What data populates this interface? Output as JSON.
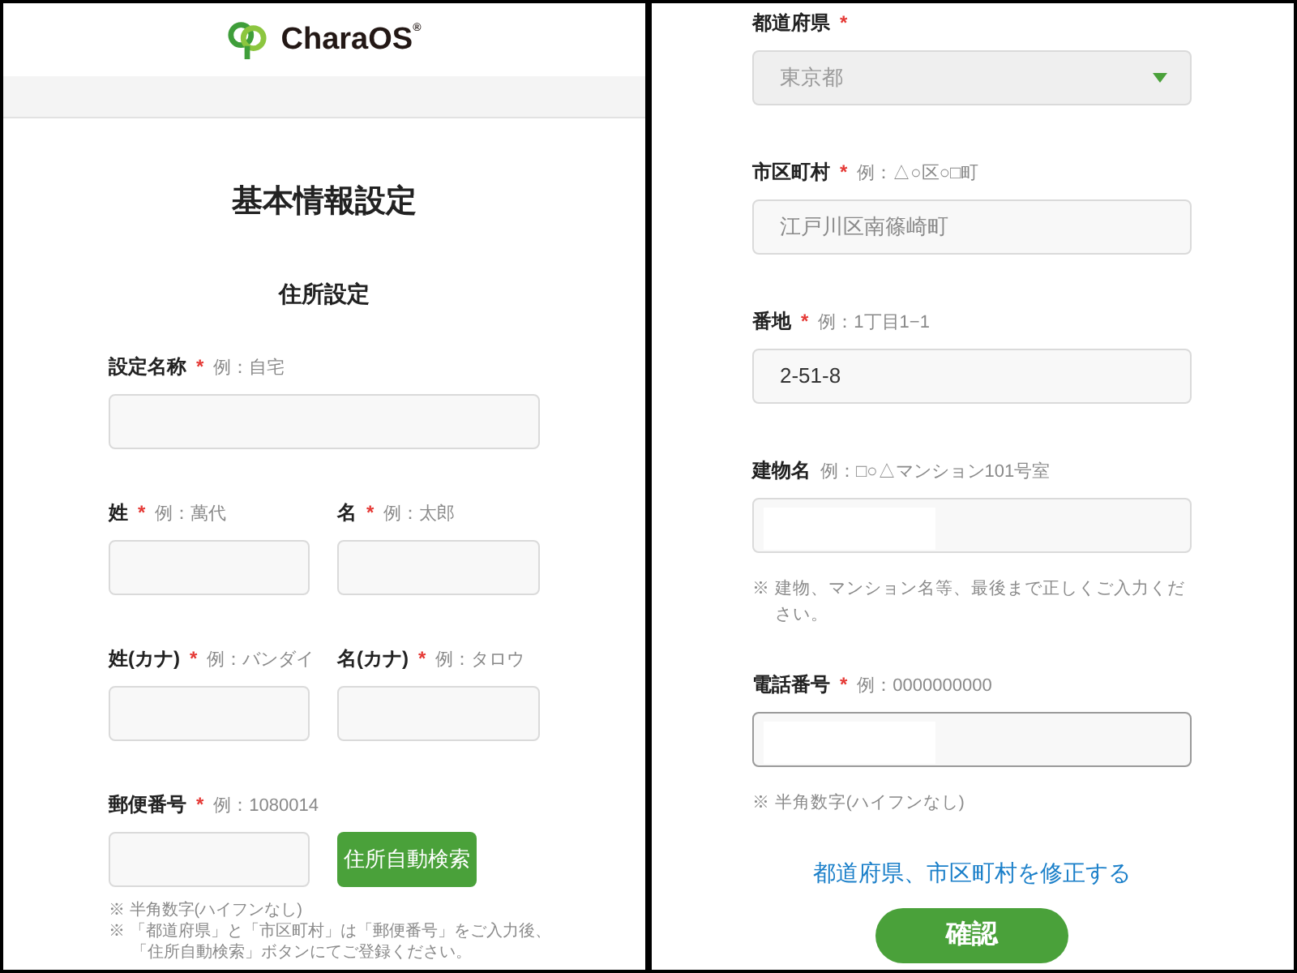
{
  "left_screen": {
    "logo": "CharaOS$^{®}$",
    "title": "基本情報設定",
    "subtitle": "住所設定",
    "rows": [
      {
        "fields": [
          {
            "label": "設定名称",
            "required_mark": "*",
            "example": "例：自宅"
          }
        ]
      },
      {
        "fields": [
          {
            "label": "姓",
            "required_mark": "*",
            "example": "例：萬代"
          },
          {
            "label": "名",
            "required_mark": "*",
            "example": "例：太郎"
          }
        ]
      },
      {
        "fields": [
          {
            "label": "姓(カナ)",
            "required_mark": "*",
            "example": "例：バンダイ"
          },
          {
            "label": "名(カナ)",
            "required_mark": "*",
            "example": "例：タロウ"
          }
        ]
      },
      {
        "fields": [
          {
            "label": "郵便番号",
            "required_mark": "*",
            "example": "例：1080014"
          }
        ],
        "button": "住所自動検索"
      }
    ],
    "notes": [
      "※ 半角数字(ハイフンなし)",
      "※ 「都道府県」と「市区町村」は「郵便番号」をご入力後、「住所自動検索」ボタンにてご登録ください。"
    ]
  },
  "right_screen": {
    "fields": [
      {
        "kind": "select",
        "label": "都道府県",
        "required_mark": "*",
        "value": "東京都",
        "disabled": true
      },
      {
        "kind": "text",
        "label": "市区町村",
        "required_mark": "*",
        "example": "例：△○区○□町",
        "value": "江戸川区南篠崎町",
        "disabled": true,
        "focused": false
      },
      {
        "kind": "text",
        "label": "番地",
        "required_mark": "*",
        "example": "例：1丁目1−1",
        "value": "2-51-8",
        "disabled": false,
        "focused": false
      },
      {
        "kind": "text",
        "label": "建物名",
        "example": "例：□○△マンション101号室",
        "redacted": true,
        "disabled": false,
        "focused": false,
        "note": "※ 建物、マンション名等、最後まで正しくご入力ください。"
      },
      {
        "kind": "text",
        "label": "電話番号",
        "required_mark": "*",
        "example": "例：0000000000",
        "redacted": true,
        "disabled": false,
        "focused": true,
        "note": "※ 半角数字(ハイフンなし)"
      }
    ],
    "link": "都道府県、市区町村を修正する",
    "submit": "確認"
  }
}
